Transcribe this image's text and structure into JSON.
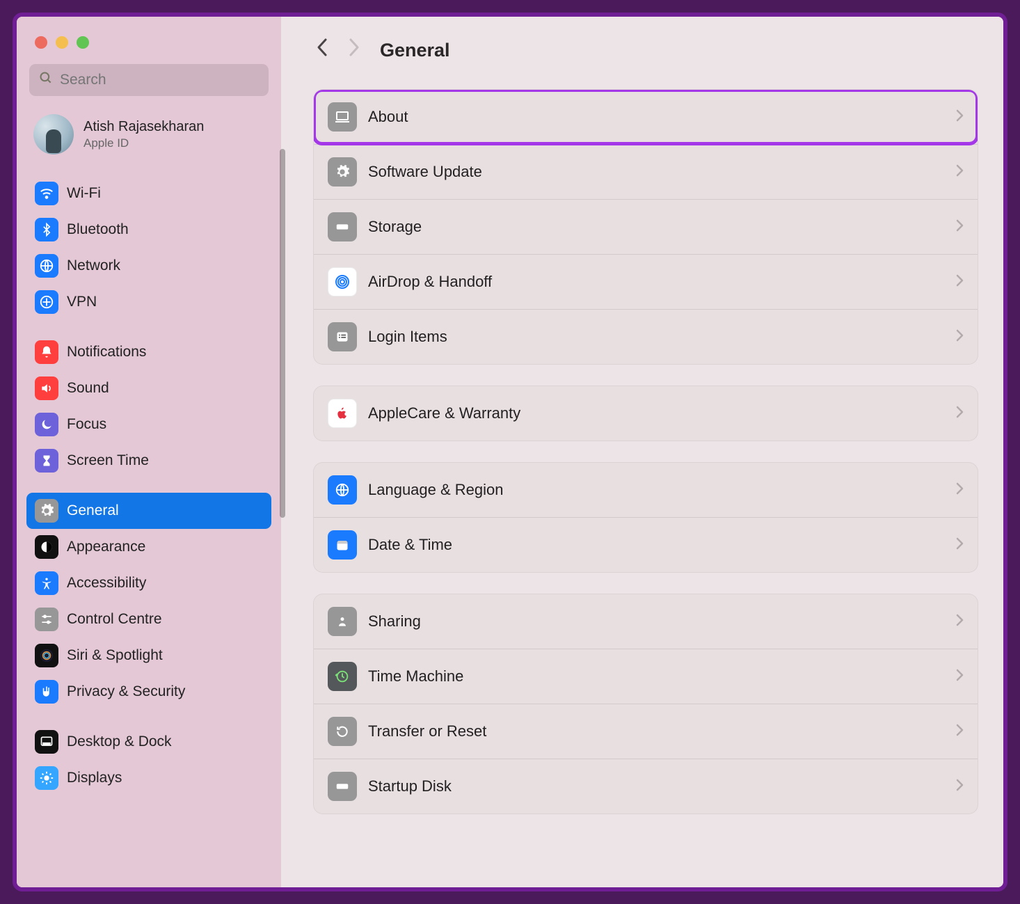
{
  "search": {
    "placeholder": "Search"
  },
  "profile": {
    "name": "Atish Rajasekharan",
    "sub": "Apple ID"
  },
  "page": {
    "title": "General"
  },
  "sidebar": {
    "g1": [
      {
        "id": "wifi",
        "label": "Wi-Fi",
        "bg": "bg-blue",
        "glyph": "wifi"
      },
      {
        "id": "bluetooth",
        "label": "Bluetooth",
        "bg": "bg-blue",
        "glyph": "bt"
      },
      {
        "id": "network",
        "label": "Network",
        "bg": "bg-blue",
        "glyph": "globe"
      },
      {
        "id": "vpn",
        "label": "VPN",
        "bg": "bg-blue",
        "glyph": "vpn"
      }
    ],
    "g2": [
      {
        "id": "notifications",
        "label": "Notifications",
        "bg": "bg-red",
        "glyph": "bell"
      },
      {
        "id": "sound",
        "label": "Sound",
        "bg": "bg-red",
        "glyph": "speaker"
      },
      {
        "id": "focus",
        "label": "Focus",
        "bg": "bg-purple",
        "glyph": "moon"
      },
      {
        "id": "screentime",
        "label": "Screen Time",
        "bg": "bg-purple",
        "glyph": "hourglass"
      }
    ],
    "g3": [
      {
        "id": "general",
        "label": "General",
        "bg": "bg-gray",
        "glyph": "gear",
        "selected": true
      },
      {
        "id": "appearance",
        "label": "Appearance",
        "bg": "bg-black",
        "glyph": "contrast"
      },
      {
        "id": "accessibility",
        "label": "Accessibility",
        "bg": "bg-blue",
        "glyph": "access"
      },
      {
        "id": "controlcentre",
        "label": "Control Centre",
        "bg": "bg-gray",
        "glyph": "sliders"
      },
      {
        "id": "siri",
        "label": "Siri & Spotlight",
        "bg": "bg-black",
        "glyph": "siri"
      },
      {
        "id": "privacy",
        "label": "Privacy & Security",
        "bg": "bg-blue",
        "glyph": "hand"
      }
    ],
    "g4": [
      {
        "id": "desktop",
        "label": "Desktop & Dock",
        "bg": "bg-black",
        "glyph": "dock"
      },
      {
        "id": "displays",
        "label": "Displays",
        "bg": "bg-sky",
        "glyph": "sun"
      }
    ]
  },
  "main": {
    "g1": [
      {
        "id": "about",
        "label": "About",
        "bg": "bg-gray",
        "glyph": "laptop",
        "highlight": true
      },
      {
        "id": "software",
        "label": "Software Update",
        "bg": "bg-gray",
        "glyph": "gear"
      },
      {
        "id": "storage",
        "label": "Storage",
        "bg": "bg-gray",
        "glyph": "disk"
      },
      {
        "id": "airdrop",
        "label": "AirDrop & Handoff",
        "bg": "bg-white",
        "glyph": "airdrop"
      },
      {
        "id": "login",
        "label": "Login Items",
        "bg": "bg-gray",
        "glyph": "list"
      }
    ],
    "g2": [
      {
        "id": "applecare",
        "label": "AppleCare & Warranty",
        "bg": "bg-white",
        "glyph": "apple"
      }
    ],
    "g3": [
      {
        "id": "language",
        "label": "Language & Region",
        "bg": "bg-blue",
        "glyph": "globe"
      },
      {
        "id": "datetime",
        "label": "Date & Time",
        "bg": "bg-blue",
        "glyph": "cal"
      }
    ],
    "g4": [
      {
        "id": "sharing",
        "label": "Sharing",
        "bg": "bg-gray",
        "glyph": "share"
      },
      {
        "id": "timemachine",
        "label": "Time Machine",
        "bg": "bg-darkgray",
        "glyph": "tm"
      },
      {
        "id": "transfer",
        "label": "Transfer or Reset",
        "bg": "bg-gray",
        "glyph": "reset"
      },
      {
        "id": "startup",
        "label": "Startup Disk",
        "bg": "bg-gray",
        "glyph": "disk"
      }
    ]
  }
}
